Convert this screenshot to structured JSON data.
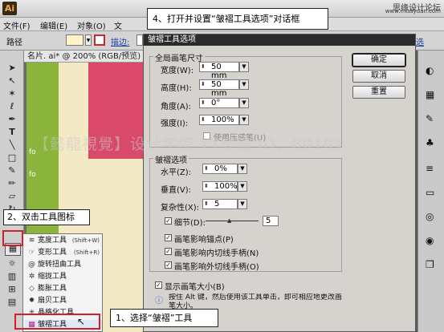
{
  "app": {
    "logo": "Ai",
    "watermark_site": "思缘设计论坛",
    "watermark_url": "www.missyuan.com"
  },
  "menu": {
    "items": [
      "文件(F)",
      "编辑(E)",
      "对象(O)",
      "文"
    ]
  },
  "control": {
    "label": "路径",
    "stroke_label": "描边:",
    "extra": "选"
  },
  "document": {
    "tab": "名片. ai* @ 200% (RGB/预览)",
    "wm_text": "【懿龍視覺】设计学院 YY频道 ID：80101"
  },
  "dialog": {
    "title": "皱褶工具选项",
    "global_group": "全局画笔尺寸",
    "width_label": "宽度(W):",
    "width_value": "50 mm",
    "height_label": "高度(H):",
    "height_value": "50 mm",
    "angle_label": "角度(A):",
    "angle_value": "0°",
    "intensity_label": "强度(I):",
    "intensity_value": "100%",
    "pressure_label": "使用压感笔(U)",
    "options_group": "皱褶选项",
    "horizontal_label": "水平(Z):",
    "horizontal_value": "0%",
    "vertical_label": "垂直(V):",
    "vertical_value": "100%",
    "complexity_label": "复杂性(X):",
    "complexity_value": "5",
    "detail_label": "细节(D):",
    "detail_value": "5",
    "anchor_label": "画笔影响锚点(P)",
    "in_label": "画笔影响内切线手柄(N)",
    "out_label": "画笔影响外切线手柄(O)",
    "show_size_label": "显示画笔大小(B)",
    "hint": "按住 Alt 键，然后使用该工具单击，即可相应地更改画笔大小。",
    "ok": "确定",
    "cancel": "取消",
    "reset": "重置"
  },
  "flyout": {
    "items": [
      {
        "label": "宽度工具",
        "shortcut": "(Shift+W)",
        "icon": "≋"
      },
      {
        "label": "变形工具",
        "shortcut": "(Shift+R)",
        "icon": "☞"
      },
      {
        "label": "旋转扭曲工具",
        "shortcut": "",
        "icon": "@"
      },
      {
        "label": "缩拢工具",
        "shortcut": "",
        "icon": "✲"
      },
      {
        "label": "膨胀工具",
        "shortcut": "",
        "icon": "◇"
      },
      {
        "label": "扇贝工具",
        "shortcut": "",
        "icon": "✹"
      },
      {
        "label": "晶格化工具",
        "shortcut": "",
        "icon": "✳"
      },
      {
        "label": "皱褶工具",
        "shortcut": "",
        "icon": "▦"
      }
    ]
  },
  "callouts": {
    "step4": "4、打开并设置“皱褶工具选项”对话框",
    "step2": "2、双击工具图标",
    "step1": "1、选择“皱褶”工具"
  },
  "colors": {
    "accent_red": "#d0202a",
    "green": "#8ab43a",
    "pink": "#d94a6a",
    "cream": "#f3e9c4"
  }
}
